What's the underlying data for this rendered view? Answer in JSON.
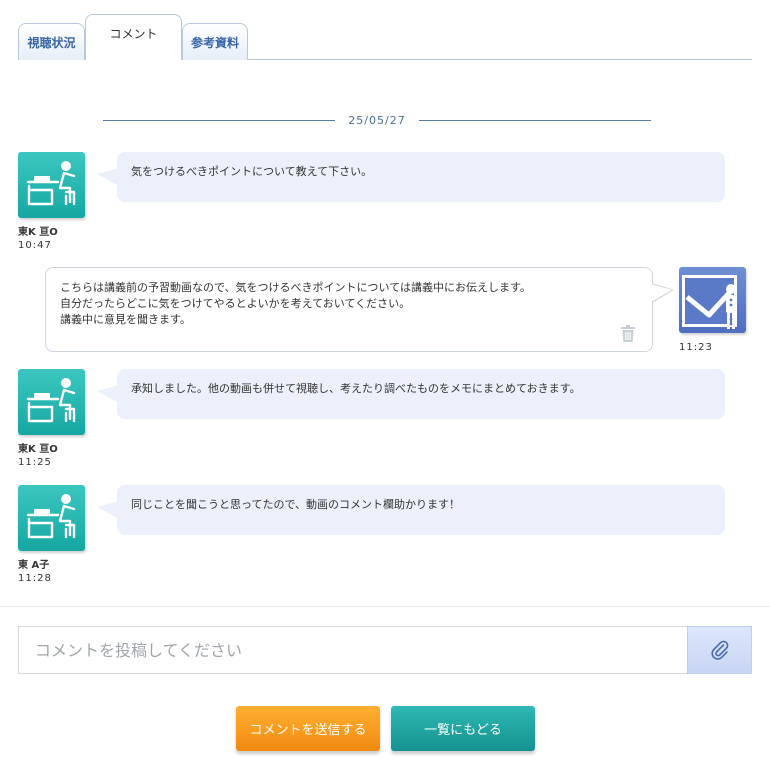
{
  "tabs": [
    {
      "label": "視聴状況"
    },
    {
      "label": "コメント"
    },
    {
      "label": "参考資料"
    }
  ],
  "date_separator": "25/05/27",
  "messages": [
    {
      "author": "東K 亘O",
      "time": "10:47",
      "lines": [
        "気をつけるべきポイントについて教えて下さい。"
      ]
    },
    {
      "author": "",
      "time": "11:23",
      "lines": [
        "こちらは講義前の予習動画なので、気をつけるべきポイントについては講義中にお伝えします。",
        "自分だったらどこに気をつけてやるとよいかを考えておいてください。",
        "講義中に意見を聞きます。"
      ]
    },
    {
      "author": "東K 亘O",
      "time": "11:25",
      "lines": [
        "承知しました。他の動画も併せて視聴し、考えたり調べたものをメモにまとめておきます。"
      ]
    },
    {
      "author": "東 A子",
      "time": "11:28",
      "lines": [
        "同じことを聞こうと思ってたので、動画のコメント欄助かります！"
      ]
    }
  ],
  "input": {
    "placeholder": "コメントを投稿してください",
    "value": ""
  },
  "buttons": {
    "send": "コメントを送信する",
    "back": "一覧にもどる"
  },
  "colors": {
    "student_avatar": "#1fb3ad",
    "teacher_avatar": "#5a7ac8",
    "send_button": "#f7a020",
    "back_button": "#1fa7a3",
    "bubble": "#ebf0fa"
  },
  "icons": {
    "student": "student-desk-icon",
    "teacher": "teacher-presentation-icon",
    "trash": "trash-icon",
    "attach": "paperclip-icon"
  }
}
